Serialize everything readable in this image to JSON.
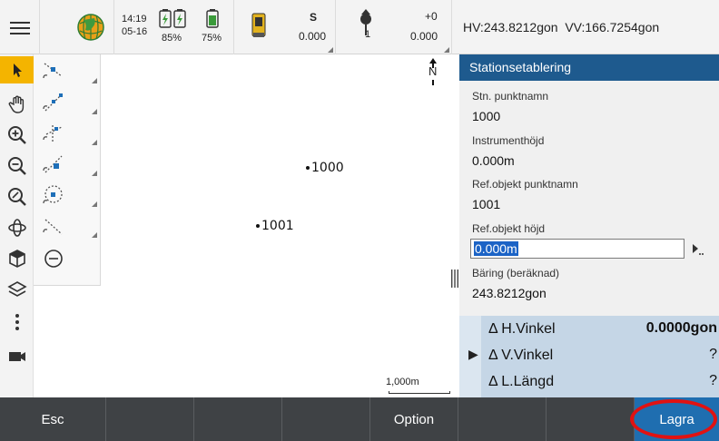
{
  "topbar": {
    "time": "14:19",
    "date": "05-16",
    "battery1_pct": "85%",
    "battery2_pct": "75%",
    "instrument_label": "S",
    "instrument_value": "0.000",
    "target_height": "+0",
    "target_number": "1",
    "target_value": "0.000",
    "angles": "HV:243.8212gon  VV:166.7254gon"
  },
  "map": {
    "north_label": "N",
    "points": [
      {
        "name": "1000"
      },
      {
        "name": "1001"
      }
    ],
    "scale": "1,000m"
  },
  "panel": {
    "title": "Stationsetablering",
    "fields": {
      "station_label": "Stn. punktnamn",
      "station_value": "1000",
      "instr_height_label": "Instrumenthöjd",
      "instr_height_value": "0.000m",
      "ref_name_label": "Ref.objekt punktnamn",
      "ref_name_value": "1001",
      "ref_height_label": "Ref.objekt höjd",
      "ref_height_value": "0.000m",
      "bearing_label": "Bäring (beräknad)",
      "bearing_value": "243.8212gon"
    }
  },
  "deltas": [
    {
      "name": "Δ H.Vinkel",
      "value": "0.0000gon"
    },
    {
      "name": "Δ V.Vinkel",
      "value": "?"
    },
    {
      "name": "Δ L.Längd",
      "value": "?"
    }
  ],
  "bottombar": {
    "esc": "Esc",
    "option": "Option",
    "save": "Lagra"
  },
  "colors": {
    "panel_header": "#1e5a8e",
    "selected_tool": "#f4b400",
    "save_button": "#1f6eb0",
    "highlight_ring": "#e01212"
  }
}
